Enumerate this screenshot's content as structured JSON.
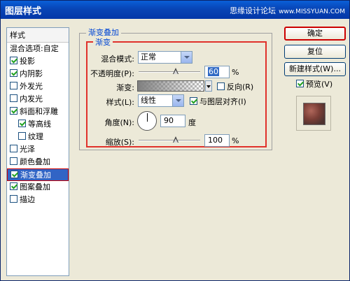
{
  "window": {
    "title": "图层样式",
    "watermark": "思缘设计论坛",
    "watermark_site": "www.MISSYUAN.COM"
  },
  "style_list": {
    "header": "样式",
    "items": [
      {
        "label": "混合选项:自定",
        "checkbox": false,
        "checked": false,
        "indent": false,
        "selected": false
      },
      {
        "label": "投影",
        "checkbox": true,
        "checked": true,
        "indent": false,
        "selected": false
      },
      {
        "label": "内阴影",
        "checkbox": true,
        "checked": true,
        "indent": false,
        "selected": false
      },
      {
        "label": "外发光",
        "checkbox": true,
        "checked": false,
        "indent": false,
        "selected": false
      },
      {
        "label": "内发光",
        "checkbox": true,
        "checked": false,
        "indent": false,
        "selected": false
      },
      {
        "label": "斜面和浮雕",
        "checkbox": true,
        "checked": true,
        "indent": false,
        "selected": false
      },
      {
        "label": "等高线",
        "checkbox": true,
        "checked": true,
        "indent": true,
        "selected": false
      },
      {
        "label": "纹理",
        "checkbox": true,
        "checked": false,
        "indent": true,
        "selected": false
      },
      {
        "label": "光泽",
        "checkbox": true,
        "checked": false,
        "indent": false,
        "selected": false
      },
      {
        "label": "颜色叠加",
        "checkbox": true,
        "checked": false,
        "indent": false,
        "selected": false
      },
      {
        "label": "渐变叠加",
        "checkbox": true,
        "checked": true,
        "indent": false,
        "selected": true
      },
      {
        "label": "图案叠加",
        "checkbox": true,
        "checked": true,
        "indent": false,
        "selected": false
      },
      {
        "label": "描边",
        "checkbox": true,
        "checked": false,
        "indent": false,
        "selected": false
      }
    ]
  },
  "panel": {
    "outer_title": "渐变叠加",
    "inner_title": "渐变",
    "blend_mode_label": "混合模式:",
    "blend_mode_value": "正常",
    "opacity_label": "不透明度(P):",
    "opacity_value": "60",
    "opacity_unit": "%",
    "opacity_level": 0.6,
    "gradient_label": "渐变:",
    "reverse_label": "反向(R)",
    "reverse_checked": false,
    "style_label": "样式(L):",
    "style_value": "线性",
    "align_label": "与图层对齐(I)",
    "align_checked": true,
    "angle_label": "角度(N):",
    "angle_value": "90",
    "angle_unit": "度",
    "scale_label": "缩放(S):",
    "scale_value": "100",
    "scale_unit": "%",
    "scale_level": 0.6
  },
  "buttons": {
    "ok": "确定",
    "reset": "复位",
    "new_style": "新建样式(W)...",
    "preview_label": "预览(V)",
    "preview_checked": true
  }
}
